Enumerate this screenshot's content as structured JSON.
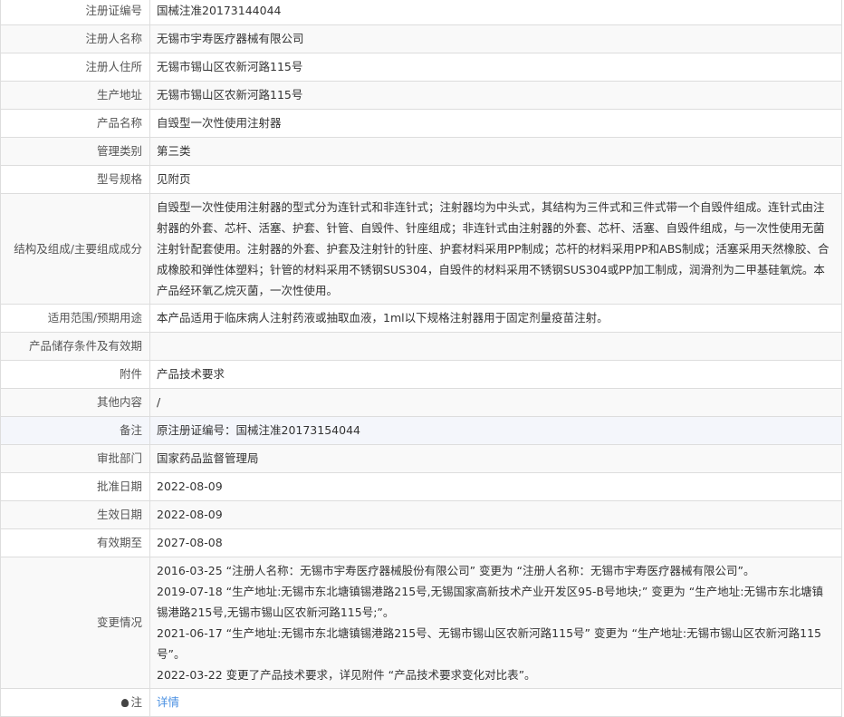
{
  "rows": [
    {
      "label": "注册证编号",
      "value": "国械注准20173144044"
    },
    {
      "label": "注册人名称",
      "value": "无锡市宇寿医疗器械有限公司"
    },
    {
      "label": "注册人住所",
      "value": "无锡市锡山区农新河路115号"
    },
    {
      "label": "生产地址",
      "value": "无锡市锡山区农新河路115号"
    },
    {
      "label": "产品名称",
      "value": "自毁型一次性使用注射器"
    },
    {
      "label": "管理类别",
      "value": "第三类"
    },
    {
      "label": "型号规格",
      "value": "见附页"
    },
    {
      "label": "结构及组成/主要组成成分",
      "value": "自毁型一次性使用注射器的型式分为连针式和非连针式；注射器均为中头式，其结构为三件式和三件式带一个自毁件组成。连针式由注射器的外套、芯杆、活塞、护套、针管、自毁件、针座组成；非连针式由注射器的外套、芯杆、活塞、自毁件组成，与一次性使用无菌注射针配套使用。注射器的外套、护套及注射针的针座、护套材料采用PP制成；芯杆的材料采用PP和ABS制成；活塞采用天然橡胶、合成橡胶和弹性体塑料；针管的材料采用不锈钢SUS304，自毁件的材料采用不锈钢SUS304或PP加工制成，润滑剂为二甲基硅氧烷。本产品经环氧乙烷灭菌，一次性使用。"
    },
    {
      "label": "适用范围/预期用途",
      "value": "本产品适用于临床病人注射药液或抽取血液，1ml以下规格注射器用于固定剂量疫苗注射。"
    },
    {
      "label": "产品储存条件及有效期",
      "value": ""
    },
    {
      "label": "附件",
      "value": "产品技术要求"
    },
    {
      "label": "其他内容",
      "value": "/"
    },
    {
      "label": "备注",
      "value": "原注册证编号：国械注准20173154044"
    },
    {
      "label": "审批部门",
      "value": "国家药品监督管理局"
    },
    {
      "label": "批准日期",
      "value": "2022-08-09"
    },
    {
      "label": "生效日期",
      "value": "2022-08-09"
    },
    {
      "label": "有效期至",
      "value": "2027-08-08"
    }
  ],
  "changes": {
    "label": "变更情况",
    "items": [
      "2016-03-25 “注册人名称：无锡市宇寿医疗器械股份有限公司” 变更为 “注册人名称：无锡市宇寿医疗器械有限公司”。",
      "2019-07-18  “生产地址:无锡市东北塘镇锡港路215号,无锡国家高新技术产业开发区95-B号地块;” 变更为 “生产地址:无锡市东北塘镇锡港路215号,无锡市锡山区农新河路115号;”。",
      "2021-06-17  “生产地址:无锡市东北塘镇锡港路215号、无锡市锡山区农新河路115号” 变更为 “生产地址:无锡市锡山区农新河路115号”。",
      "2022-03-22 变更了产品技术要求，详见附件 “产品技术要求变化对比表”。"
    ]
  },
  "note": {
    "label": "注",
    "link": "详情"
  }
}
